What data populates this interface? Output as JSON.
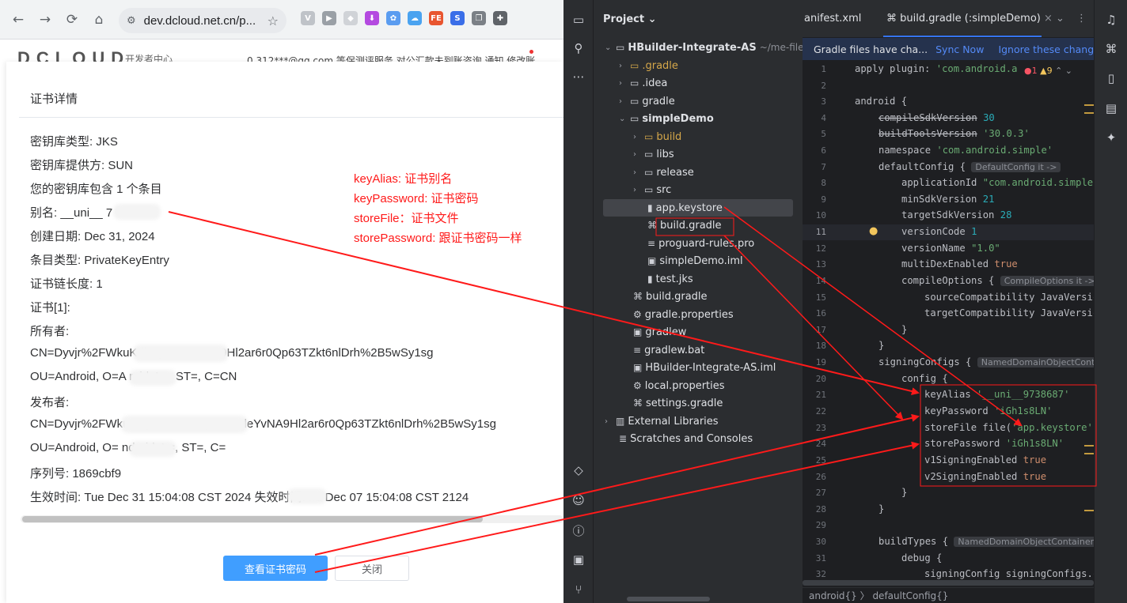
{
  "browser": {
    "url": "dev.dcloud.net.cn/p...",
    "site": {
      "logo": "DCLOUD",
      "dev_center": "开发者中心",
      "nav": "0 312***@qq.com   等保测评服务   对公汇款未到账咨询   通知   修改账"
    },
    "dialog": {
      "title": "证书详情",
      "lines": [
        "密钥库类型:  JKS",
        "密钥库提供方:  SUN",
        "您的密钥库包含 1 个条目",
        "别名:  __uni__       7",
        "创建日期:  Dec 31, 2024",
        "条目类型:  PrivateKeyEntry",
        "证书链长度:  1",
        "证书[1]:",
        "所有者:",
        "CN=Dyvjr%2FWkuKdl5Qo9sv        YvNA9Hl2ar6r0Qp63TZkt6nlDrh%2B5wSy1sg",
        "OU=Android, O=A       roid, L=, ST=, C=CN",
        "发布者:",
        "CN=Dyvjr%2FWkuK     Qo9sv          ZB6QKcB94leYvNA9Hl2ar6r0Qp63TZkt6nlDrh%2B5wSy1sg",
        "OU=Android, O=    ndroid, L=, ST=, C=",
        "序列号:  1869cbf9",
        "生效时间:  Tue Dec 31 15:04:08 CST 2024 失效时间:    hu Dec 07 15:04:08 CST 2124"
      ],
      "view_password_button": "查看证书密码",
      "close_button": "关闭"
    }
  },
  "annotations": [
    "keyAlias: 证书别名",
    "keyPassword: 证书密码",
    "storeFile：证书文件",
    "storePassword: 跟证书密码一样"
  ],
  "ide": {
    "project_title": "Project ⌄",
    "tree": [
      {
        "label": "HBuilder-Integrate-AS",
        "path": "~/me-file/fro"
      },
      {
        "label": ".gradle"
      },
      {
        "label": ".idea"
      },
      {
        "label": "gradle"
      },
      {
        "label": "simpleDemo"
      },
      {
        "label": "build"
      },
      {
        "label": "libs"
      },
      {
        "label": "release"
      },
      {
        "label": "src"
      },
      {
        "label": "app.keystore"
      },
      {
        "label": "build.gradle"
      },
      {
        "label": "proguard-rules.pro"
      },
      {
        "label": "simpleDemo.iml"
      },
      {
        "label": "test.jks"
      },
      {
        "label": "build.gradle"
      },
      {
        "label": "gradle.properties"
      },
      {
        "label": "gradlew"
      },
      {
        "label": "gradlew.bat"
      },
      {
        "label": "HBuilder-Integrate-AS.iml"
      },
      {
        "label": "local.properties"
      },
      {
        "label": "settings.gradle"
      },
      {
        "label": "External Libraries"
      },
      {
        "label": "Scratches and Consoles"
      }
    ],
    "tabs": {
      "inactive": "anifest.xml",
      "active": "build.gradle (:simpleDemo)"
    },
    "banner": {
      "message": "Gradle files have cha...",
      "sync": "Sync Now",
      "ignore": "Ignore these changes"
    },
    "inspections": {
      "errors": "1",
      "warnings": "9"
    },
    "hints": {
      "default_config": "DefaultConfig it ->",
      "compile_options": "CompileOptions it ->",
      "signing_configs": "NamedDomainObjectConta",
      "build_types": "NamedDomainObjectContainer<"
    },
    "code": {
      "l1a": "apply plugin: ",
      "l1b": "'com.android.a",
      "l3": "android {",
      "l4a": "compileSdkVersion",
      "l4b": "30",
      "l5a": "buildToolsVersion",
      "l5b": "'30.0.3'",
      "l6a": "namespace ",
      "l6b": "'com.android.simple'",
      "l7": "defaultConfig {",
      "l8a": "applicationId ",
      "l8b": "\"com.android.simple",
      "l9a": "minSdkVersion ",
      "l9b": "21",
      "l10a": "targetSdkVersion ",
      "l10b": "28",
      "l11a": "versionCode ",
      "l11b": "1",
      "l12a": "versionName ",
      "l12b": "\"1.0\"",
      "l13a": "multiDexEnabled ",
      "l13b": "true",
      "l14": "compileOptions {",
      "l15": "sourceCompatibility JavaVersic",
      "l16": "targetCompatibility JavaVersic",
      "l17": "}",
      "l18": "}",
      "l19": "signingConfigs {",
      "l20": "config {",
      "l21a": "keyAlias ",
      "l21b": "'__uni__9738687'",
      "l22a": "keyPassword ",
      "l22b": "'iGh1s8LN'",
      "l23a": "storeFile file(",
      "l23b": "'app.keystore'",
      "l23c": ")",
      "l24a": "storePassword ",
      "l24b": "'iGh1s8LN'",
      "l25a": "v1SigningEnabled ",
      "l25b": "true",
      "l26a": "v2SigningEnabled ",
      "l26b": "true",
      "l27": "}",
      "l28": "}",
      "l30": "buildTypes {",
      "l31": "debug {",
      "l32": "signingConfig signingConfigs.c"
    },
    "breadcrumb": "android{}  〉 defaultConfig{}"
  },
  "colors": {
    "annotation_red": "#ff1a1a",
    "primary_button": "#409eff",
    "ide_background": "#1e1f22",
    "ide_panel": "#2b2d30",
    "link_blue": "#548af7"
  }
}
